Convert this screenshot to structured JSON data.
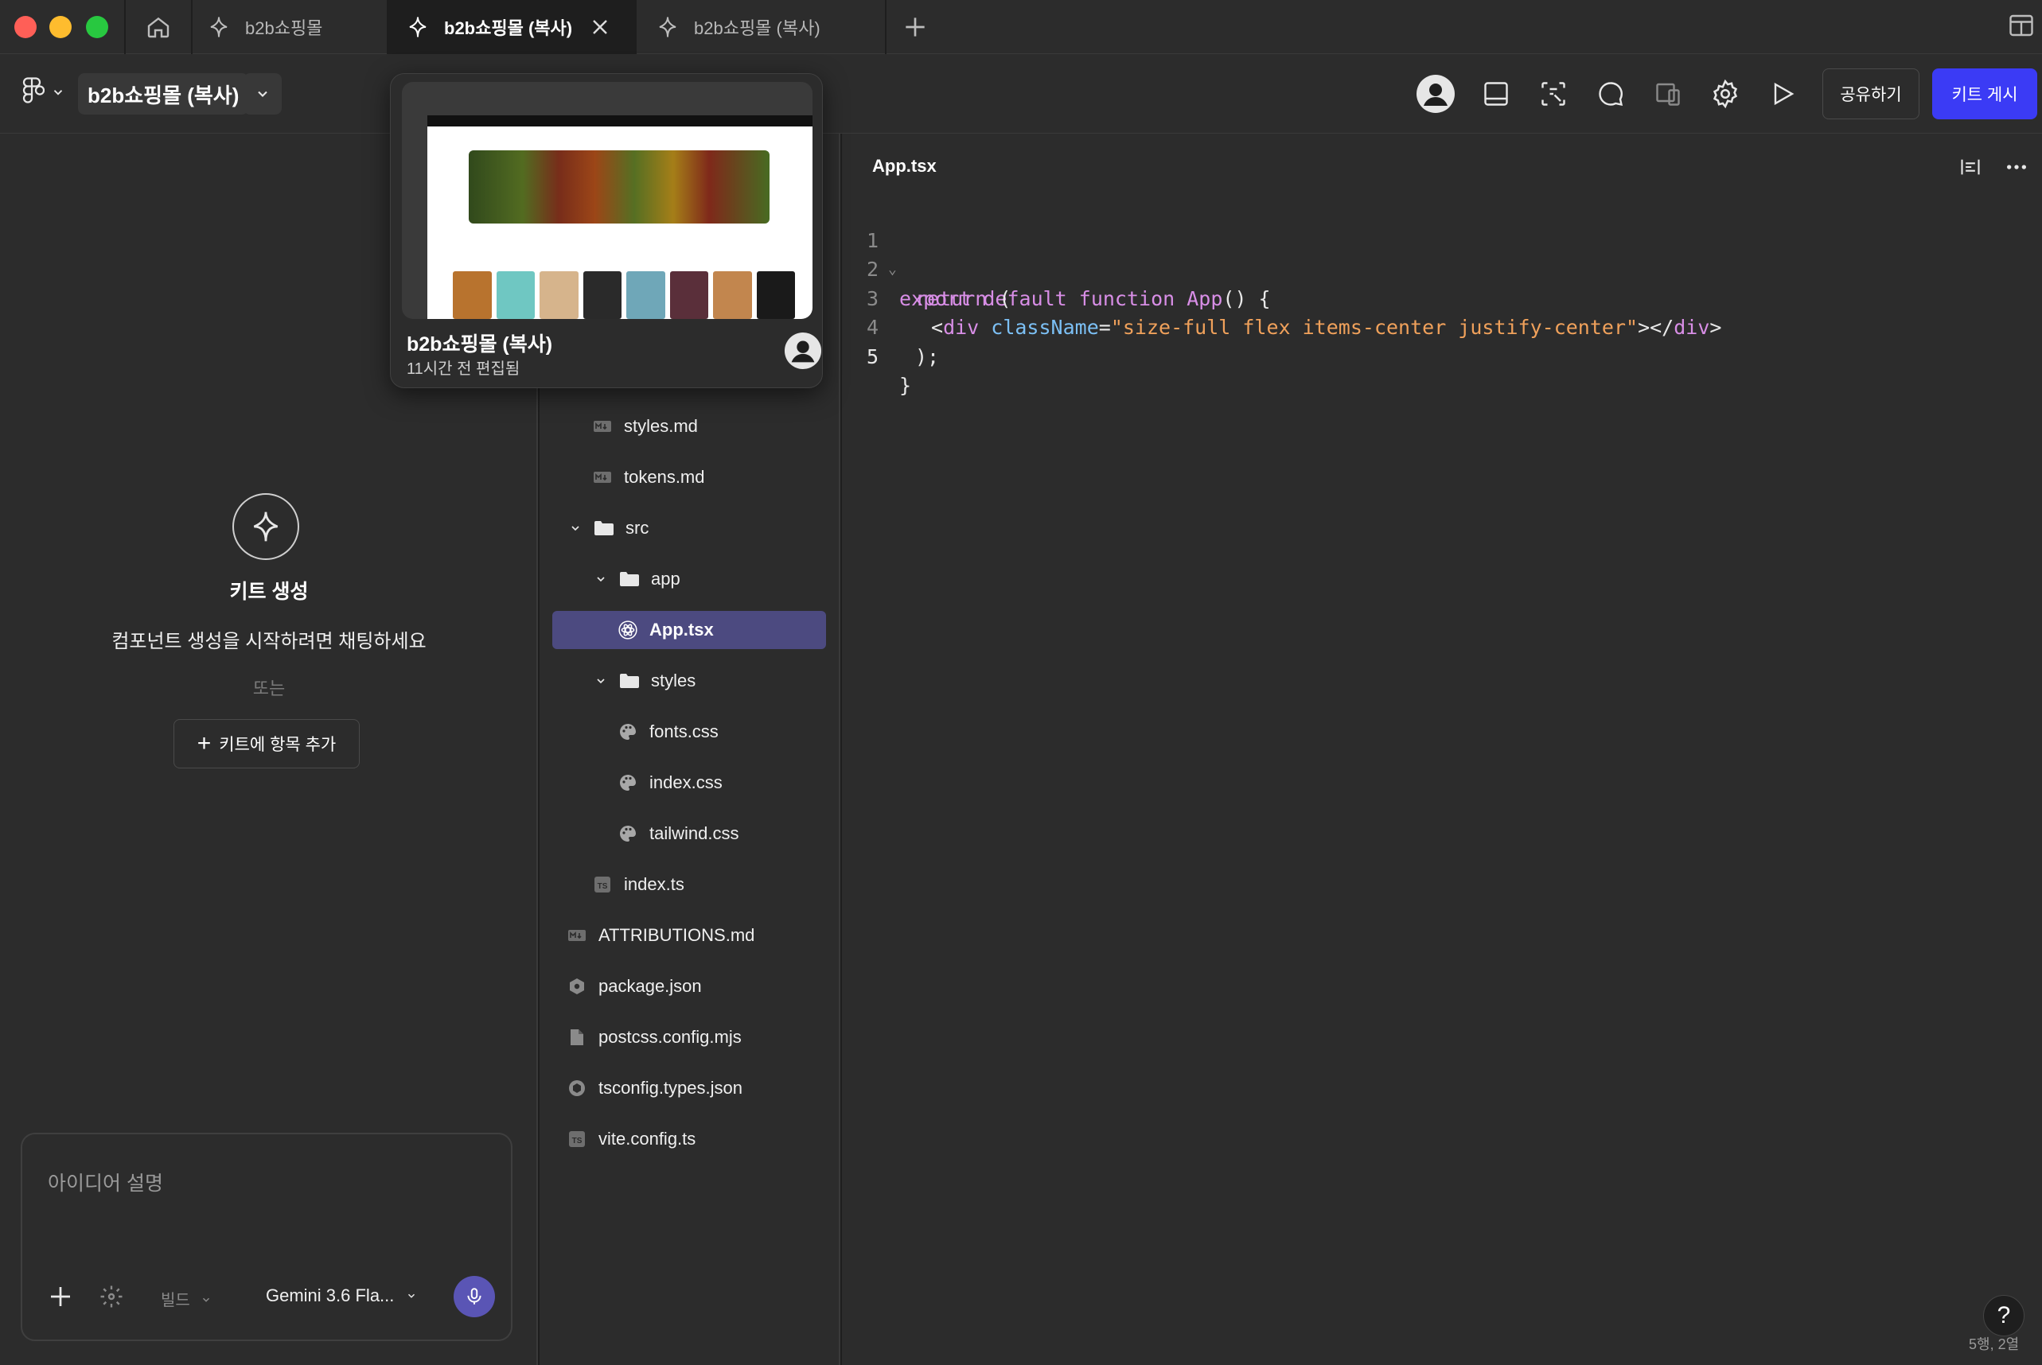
{
  "tabs": [
    {
      "label": "b2b쇼핑몰",
      "active": false
    },
    {
      "label": "b2b쇼핑몰 (복사)",
      "active": true
    },
    {
      "label": "b2b쇼핑몰 (복사)",
      "active": false
    }
  ],
  "toolbar": {
    "file_name": "b2b쇼핑몰 (복사)",
    "share_label": "공유하기",
    "publish_label": "키트 게시",
    "icons": [
      "avatar-icon",
      "layout-panel-icon",
      "inspect-icon",
      "comment-icon",
      "devices-icon",
      "settings-icon",
      "play-icon"
    ]
  },
  "preview_card": {
    "title": "b2b쇼핑몰 (복사)",
    "subtitle": "11시간 전 편집됨"
  },
  "chat": {
    "kit_title": "키트 생성",
    "kit_subtitle": "컴포넌트 생성을 시작하려면 채팅하세요",
    "or_label": "또는",
    "add_label": "키트에 항목 추가",
    "placeholder": "아이디어 설명",
    "mode_label": "빌드",
    "model_label": "Gemini 3.6 Fla..."
  },
  "file_tree": {
    "items": [
      {
        "name": "styles.md",
        "icon": "markdown-icon",
        "indent": 1
      },
      {
        "name": "tokens.md",
        "icon": "markdown-icon",
        "indent": 1
      },
      {
        "name": "src",
        "icon": "folder-icon",
        "indent": 0,
        "expanded": true
      },
      {
        "name": "app",
        "icon": "folder-icon",
        "indent": 1,
        "expanded": true
      },
      {
        "name": "App.tsx",
        "icon": "react-icon",
        "indent": 2,
        "selected": true
      },
      {
        "name": "styles",
        "icon": "folder-icon",
        "indent": 1,
        "expanded": true
      },
      {
        "name": "fonts.css",
        "icon": "palette-icon",
        "indent": 2
      },
      {
        "name": "index.css",
        "icon": "palette-icon",
        "indent": 2
      },
      {
        "name": "tailwind.css",
        "icon": "palette-icon",
        "indent": 2
      },
      {
        "name": "index.ts",
        "icon": "typescript-icon",
        "indent": 1
      },
      {
        "name": "ATTRIBUTIONS.md",
        "icon": "markdown-icon",
        "indent": 0
      },
      {
        "name": "package.json",
        "icon": "hexagon-icon",
        "indent": 0
      },
      {
        "name": "postcss.config.mjs",
        "icon": "file-icon",
        "indent": 0
      },
      {
        "name": "tsconfig.types.json",
        "icon": "settings-hex-icon",
        "indent": 0
      },
      {
        "name": "vite.config.ts",
        "icon": "typescript-icon",
        "indent": 0
      }
    ]
  },
  "editor": {
    "file_title": "App.tsx",
    "line_numbers": [
      "1",
      "2",
      "3",
      "4",
      "5"
    ],
    "status": "5행, 2열",
    "help_label": "?"
  },
  "colors": {
    "accent": "#3b3bf5",
    "selected_row": "#4c4a80",
    "mic": "#5a55b5",
    "code_keyword": "#d88ee6",
    "code_attr": "#7cc0f5",
    "code_string": "#f0a15b"
  }
}
